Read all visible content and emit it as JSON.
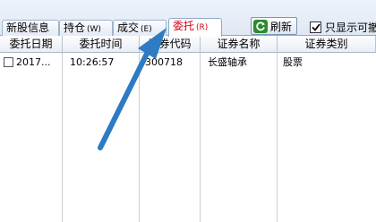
{
  "tabs": [
    {
      "label": "新股信息",
      "hotkey": "",
      "active": false
    },
    {
      "label": "持仓",
      "hotkey": "(W)",
      "active": false
    },
    {
      "label": "成交",
      "hotkey": "(E)",
      "active": false
    },
    {
      "label": "委托",
      "hotkey": "(R)",
      "active": true
    }
  ],
  "toolbar": {
    "refresh_label": "刷新",
    "refresh_icon": "refresh-icon",
    "only_show_label": "只显示可撤",
    "only_show_checked": true
  },
  "table": {
    "columns": [
      "委托日期",
      "委托时间",
      "证券代码",
      "证券名称",
      "证券类别"
    ],
    "rows": [
      {
        "date": "2017...",
        "time": "10:26:57",
        "code": "300718",
        "name": "长盛轴承",
        "category": "股票"
      }
    ]
  },
  "annotation": {
    "type": "arrow",
    "color": "#2e7bc4"
  },
  "colors": {
    "active_tab_text": "#d3001a",
    "tab_border": "#8fa9c9",
    "refresh_green": "#2d8a2d"
  }
}
